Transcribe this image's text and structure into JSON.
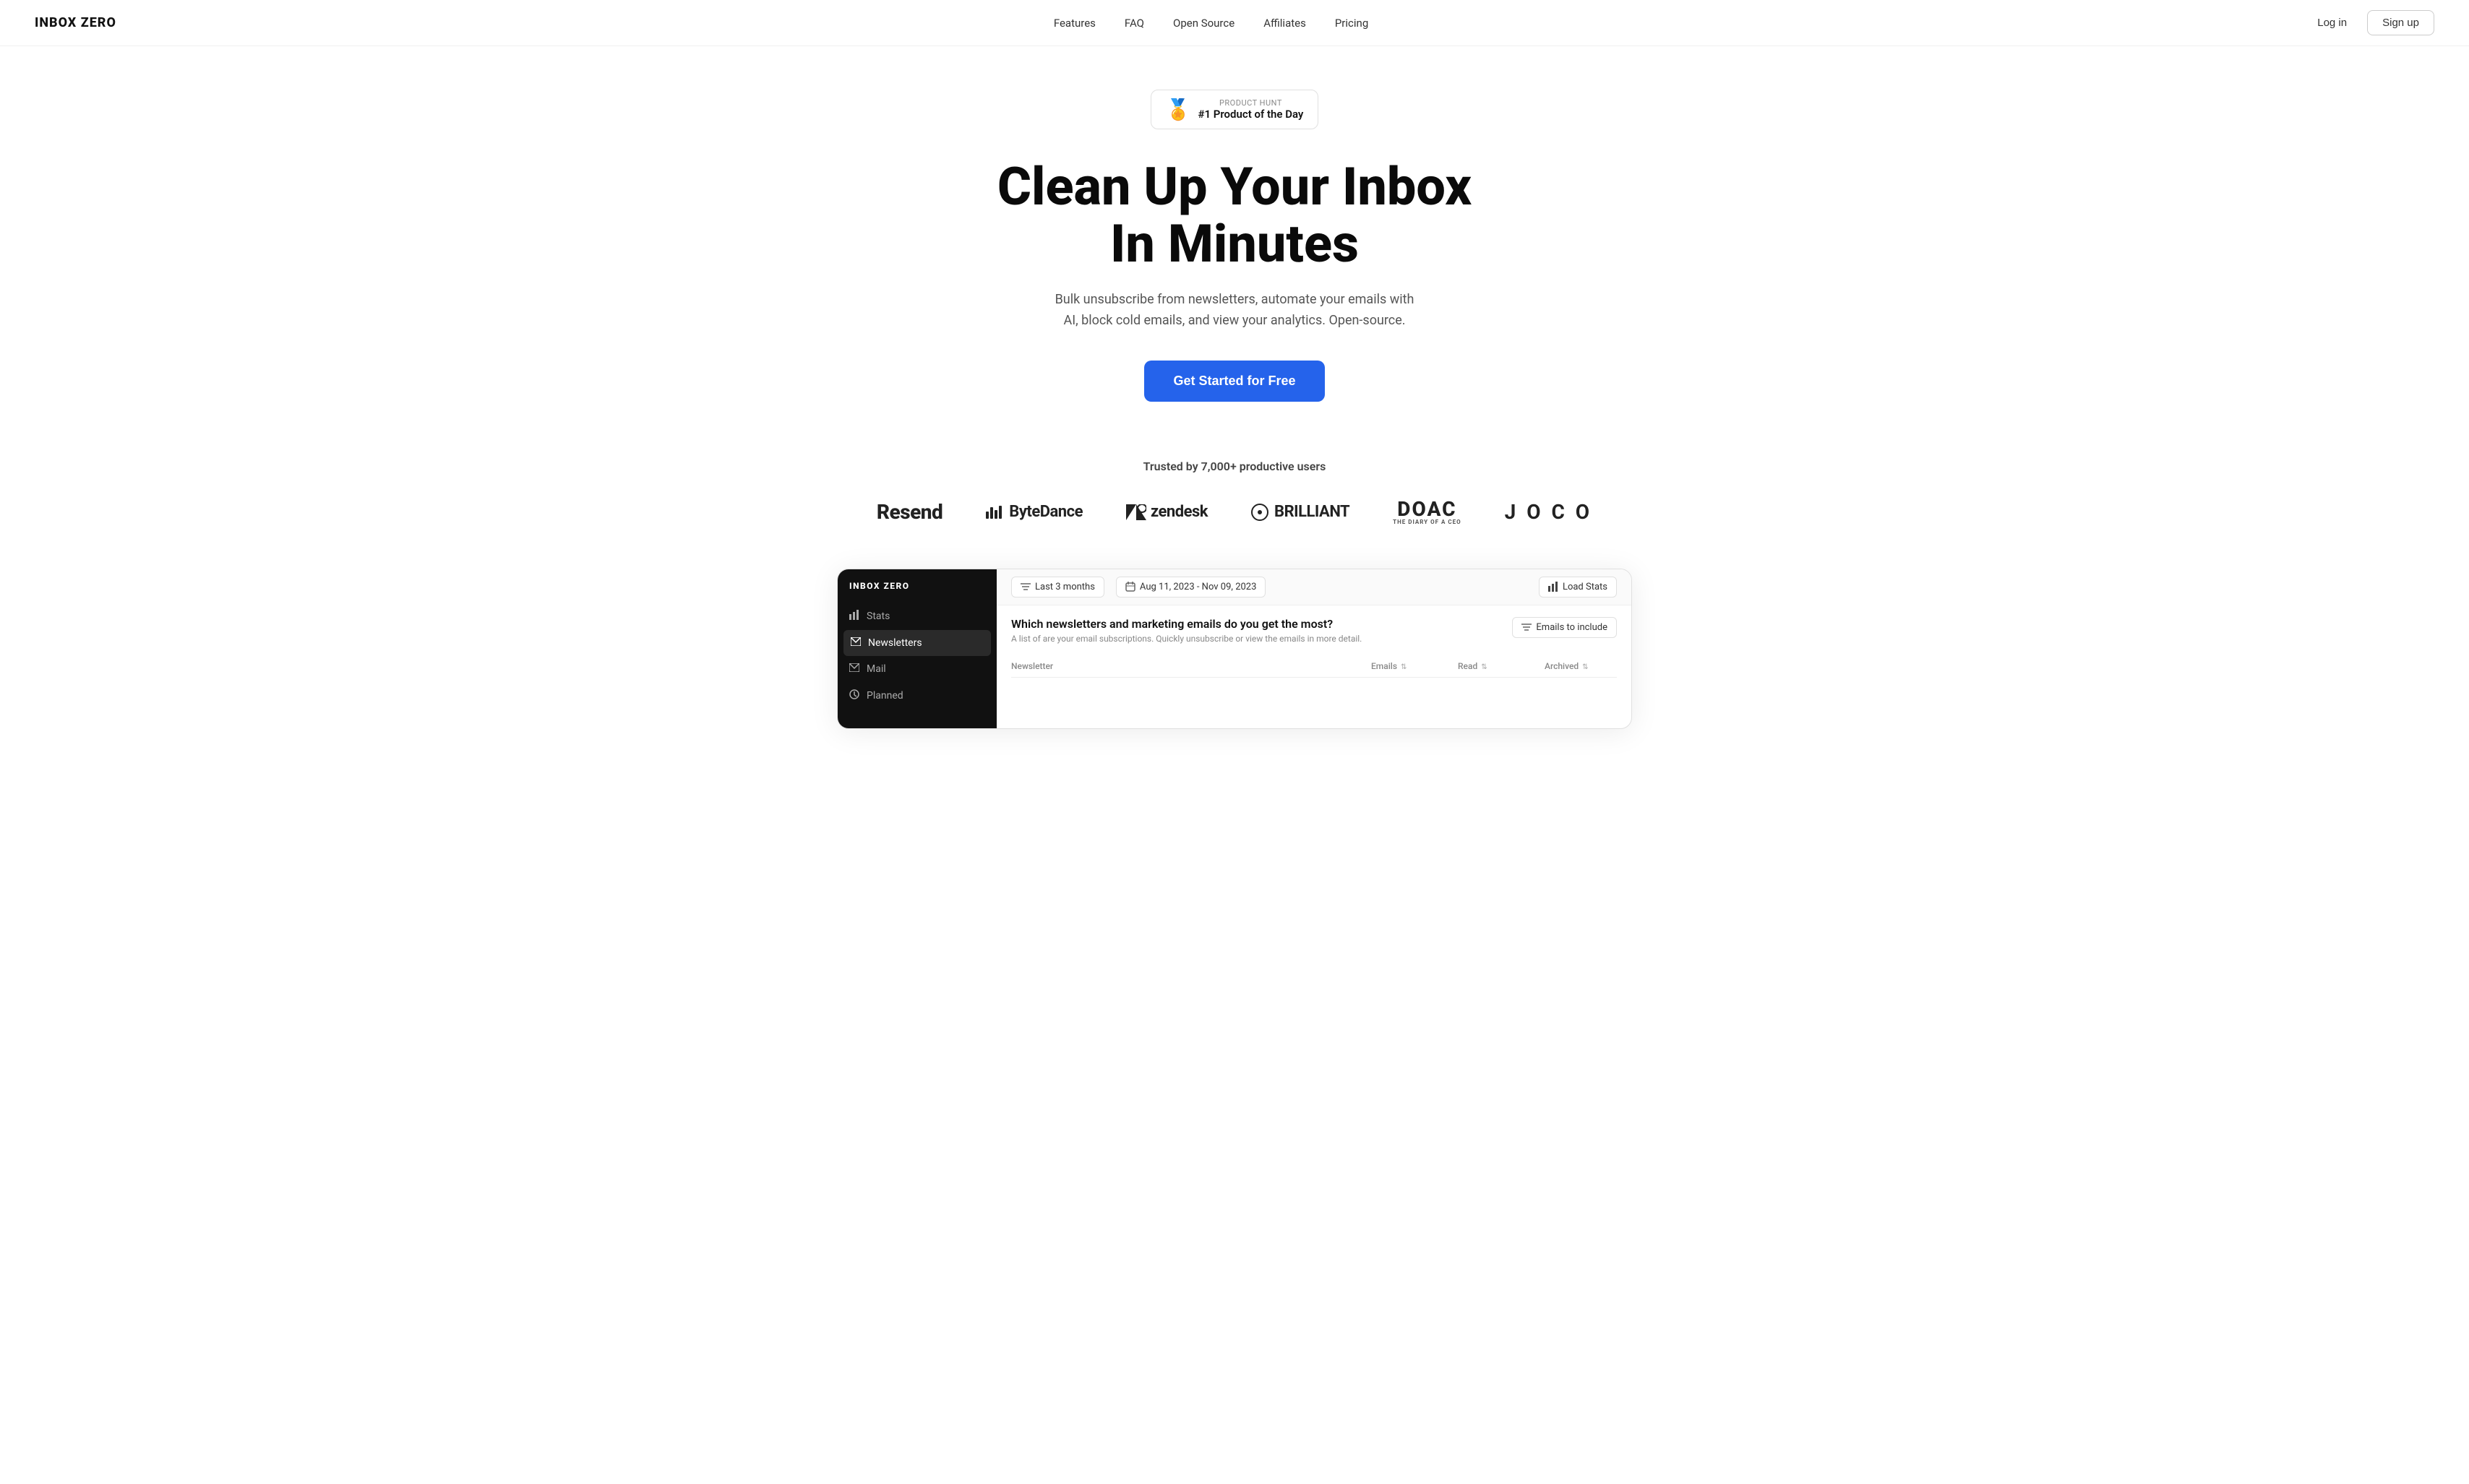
{
  "navbar": {
    "logo": "INBOX ZERO",
    "links": [
      {
        "label": "Features",
        "id": "features"
      },
      {
        "label": "FAQ",
        "id": "faq"
      },
      {
        "label": "Open Source",
        "id": "open-source"
      },
      {
        "label": "Affiliates",
        "id": "affiliates"
      },
      {
        "label": "Pricing",
        "id": "pricing"
      }
    ],
    "login_label": "Log in",
    "signup_label": "Sign up"
  },
  "hero": {
    "badge_label": "PRODUCT HUNT",
    "badge_title": "#1 Product of the Day",
    "title_line1": "Clean Up Your Inbox",
    "title_line2": "In Minutes",
    "subtitle": "Bulk unsubscribe from newsletters, automate your emails with AI, block cold emails, and view your analytics. Open-source.",
    "cta_label": "Get Started for Free"
  },
  "trusted": {
    "label": "Trusted by 7,000+ productive users",
    "logos": [
      {
        "id": "resend",
        "text": "Resend"
      },
      {
        "id": "bytedance",
        "text": "ByteDance"
      },
      {
        "id": "zendesk",
        "text": "zendesk"
      },
      {
        "id": "brilliant",
        "text": "BRILLIANT"
      },
      {
        "id": "doac",
        "text": "DOAC",
        "sub": "THE DIARY OF A CEO"
      },
      {
        "id": "joco",
        "text": "J O C O"
      }
    ]
  },
  "app_preview": {
    "sidebar_logo": "INBOX ZERO",
    "sidebar_items": [
      {
        "label": "Stats",
        "icon": "📊",
        "id": "stats"
      },
      {
        "label": "Newsletters",
        "icon": "📧",
        "id": "newsletters",
        "active": true
      },
      {
        "label": "Mail",
        "icon": "✉️",
        "id": "mail"
      },
      {
        "label": "Planned",
        "icon": "⚙️",
        "id": "planned"
      }
    ],
    "toolbar": {
      "date_range_label": "Last 3 months",
      "date_range_icon": "≡",
      "date_label": "Aug 11, 2023 - Nov 09, 2023",
      "date_icon": "📅",
      "load_stats_label": "Load Stats",
      "load_stats_icon": "📊"
    },
    "content": {
      "title": "Which newsletters and marketing emails do you get the most?",
      "subtitle": "A list of are your email subscriptions. Quickly unsubscribe or view the emails in more detail.",
      "filter_label": "Emails to include",
      "table_headers": [
        {
          "label": "Newsletter",
          "id": "newsletter-col"
        },
        {
          "label": "Emails",
          "sortable": true,
          "id": "emails-col"
        },
        {
          "label": "Read",
          "sortable": true,
          "id": "read-col"
        },
        {
          "label": "Archived",
          "sortable": true,
          "id": "archived-col"
        }
      ]
    }
  }
}
